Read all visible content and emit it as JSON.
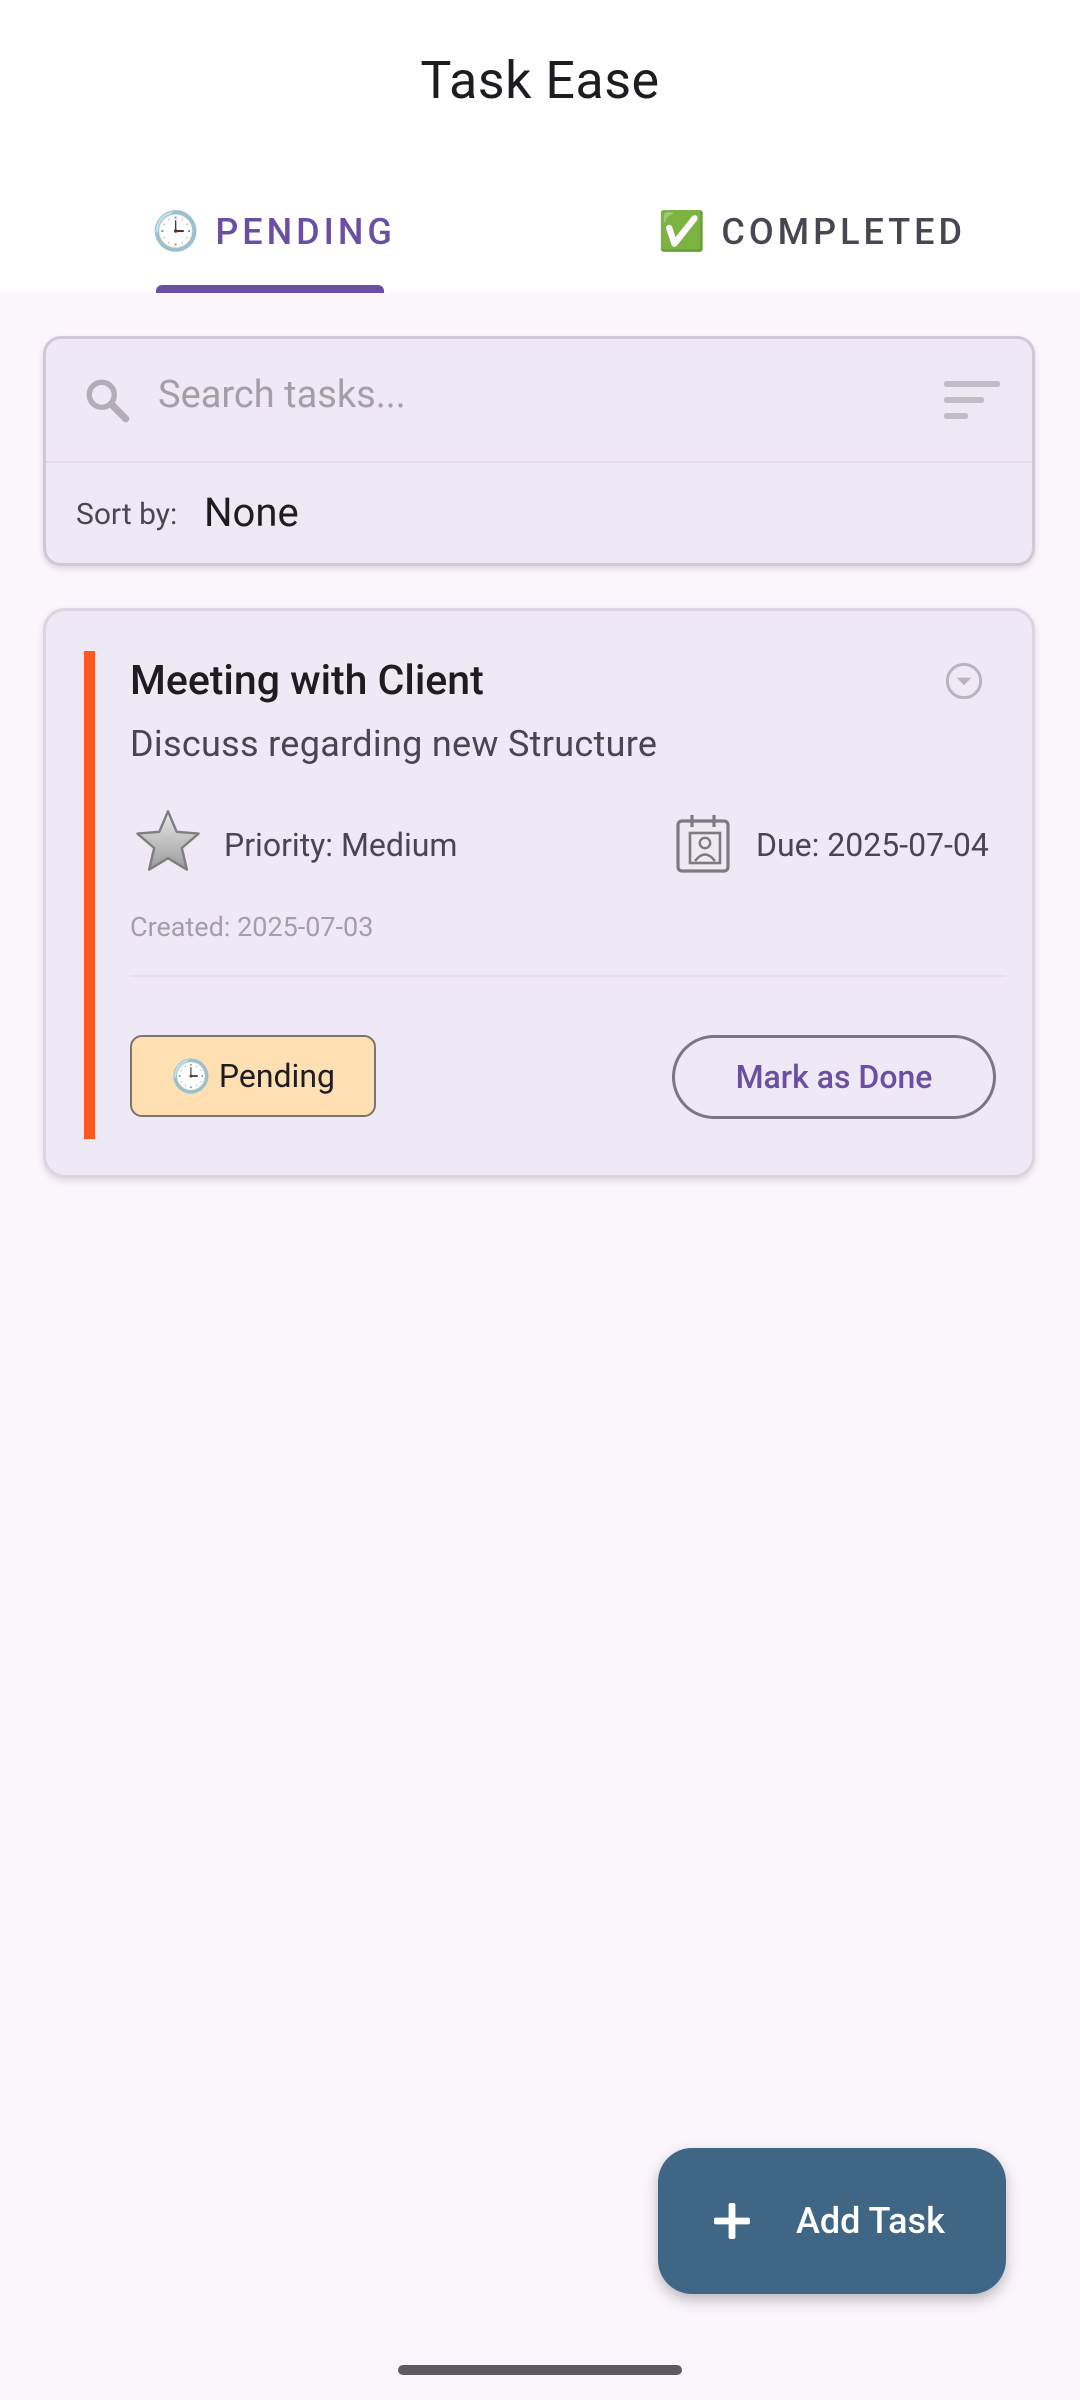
{
  "app": {
    "title": "Task Ease"
  },
  "tabs": [
    {
      "emoji": "🕒",
      "label": "PENDING",
      "selected": true
    },
    {
      "emoji": "✅",
      "label": "COMPLETED",
      "selected": false
    }
  ],
  "search": {
    "placeholder": "Search tasks...",
    "sort_label": "Sort by:",
    "sort_value": "None"
  },
  "tasks": [
    {
      "title": "Meeting with Client",
      "description": "Discuss regarding new Structure",
      "priority": "Priority: Medium",
      "due": "Due: 2025-07-04",
      "created": "Created: 2025-07-03",
      "status_emoji": "🕒",
      "status": "Pending",
      "action": "Mark as Done",
      "accent_color": "#FF5722",
      "status_bg": "#FFE0B2"
    }
  ],
  "fab": {
    "label": "Add Task",
    "icon": "plus-icon"
  },
  "colors": {
    "primary": "#6A4FA3",
    "fab": "#3F6685",
    "background": "#FBF5FC",
    "card": "#EFE8F5"
  },
  "icons": [
    "search-icon",
    "filter-icon",
    "expand-icon",
    "star-icon",
    "calendar-icon",
    "plus-icon"
  ]
}
